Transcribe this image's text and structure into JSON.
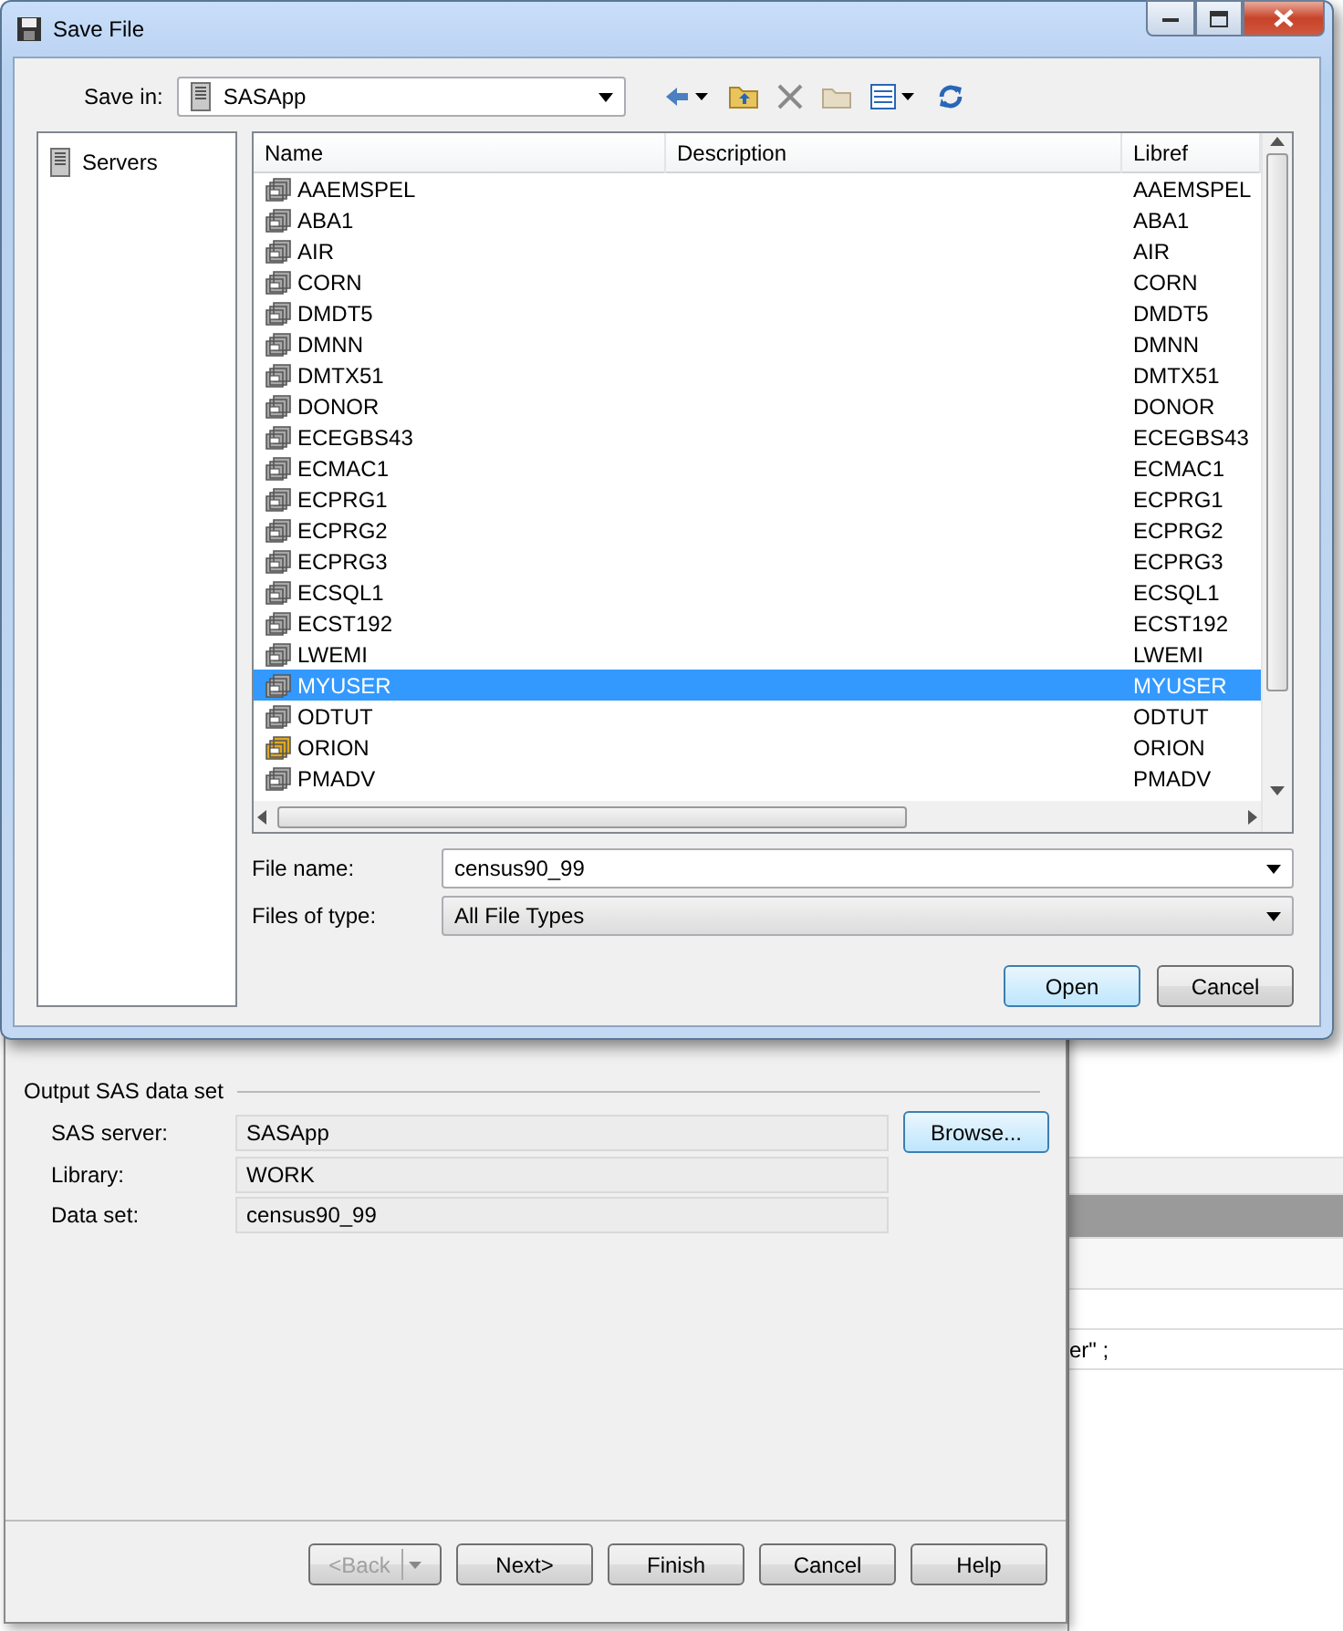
{
  "dialog": {
    "title": "Save File",
    "save_in": {
      "label": "Save in:",
      "value": "SASApp"
    },
    "sidebar": {
      "items": [
        {
          "label": "Servers",
          "selected": false
        }
      ]
    },
    "list": {
      "columns": [
        "Name",
        "Description",
        "Libref"
      ],
      "rows": [
        {
          "name": "AAEMSPEL",
          "libref": "AAEMSPEL",
          "selected": false,
          "color": "#a8a8a8"
        },
        {
          "name": "ABA1",
          "libref": "ABA1",
          "selected": false,
          "color": "#a8a8a8"
        },
        {
          "name": "AIR",
          "libref": "AIR",
          "selected": false,
          "color": "#a8a8a8"
        },
        {
          "name": "CORN",
          "libref": "CORN",
          "selected": false,
          "color": "#a8a8a8"
        },
        {
          "name": "DMDT5",
          "libref": "DMDT5",
          "selected": false,
          "color": "#a8a8a8"
        },
        {
          "name": "DMNN",
          "libref": "DMNN",
          "selected": false,
          "color": "#a8a8a8"
        },
        {
          "name": "DMTX51",
          "libref": "DMTX51",
          "selected": false,
          "color": "#a8a8a8"
        },
        {
          "name": "DONOR",
          "libref": "DONOR",
          "selected": false,
          "color": "#a8a8a8"
        },
        {
          "name": "ECEGBS43",
          "libref": "ECEGBS43",
          "selected": false,
          "color": "#a8a8a8"
        },
        {
          "name": "ECMAC1",
          "libref": "ECMAC1",
          "selected": false,
          "color": "#a8a8a8"
        },
        {
          "name": "ECPRG1",
          "libref": "ECPRG1",
          "selected": false,
          "color": "#a8a8a8"
        },
        {
          "name": "ECPRG2",
          "libref": "ECPRG2",
          "selected": false,
          "color": "#a8a8a8"
        },
        {
          "name": "ECPRG3",
          "libref": "ECPRG3",
          "selected": false,
          "color": "#a8a8a8"
        },
        {
          "name": "ECSQL1",
          "libref": "ECSQL1",
          "selected": false,
          "color": "#a8a8a8"
        },
        {
          "name": "ECST192",
          "libref": "ECST192",
          "selected": false,
          "color": "#a8a8a8"
        },
        {
          "name": "LWEMI",
          "libref": "LWEMI",
          "selected": false,
          "color": "#a8a8a8"
        },
        {
          "name": "MYUSER",
          "libref": "MYUSER",
          "selected": true,
          "color": "#a8a8a8"
        },
        {
          "name": "ODTUT",
          "libref": "ODTUT",
          "selected": false,
          "color": "#a8a8a8"
        },
        {
          "name": "ORION",
          "libref": "ORION",
          "selected": false,
          "color": "#e0a820"
        },
        {
          "name": "PMADV",
          "libref": "PMADV",
          "selected": false,
          "color": "#a8a8a8"
        }
      ]
    },
    "file_name": {
      "label": "File name:",
      "value": "census90_99"
    },
    "file_type": {
      "label": "Files of type:",
      "value": "All File Types"
    },
    "buttons": [
      {
        "label": "Open",
        "default": true
      },
      {
        "label": "Cancel",
        "default": false
      }
    ]
  },
  "wizard": {
    "section": "Output SAS data set",
    "fields": [
      {
        "label": "SAS server:",
        "value": "SASApp"
      },
      {
        "label": "Library:",
        "value": "WORK"
      },
      {
        "label": "Data set:",
        "value": "census90_99"
      }
    ],
    "browse": "Browse...",
    "buttons": [
      {
        "label": "<Back",
        "disabled": true,
        "kind": "split"
      },
      {
        "label": "Next>",
        "disabled": false,
        "kind": "plain"
      },
      {
        "label": "Finish",
        "disabled": false,
        "kind": "plain"
      },
      {
        "label": "Cancel",
        "disabled": false,
        "kind": "plain"
      },
      {
        "label": "Help",
        "disabled": false,
        "kind": "plain"
      }
    ]
  },
  "background_window": {
    "text": "er\" ;"
  }
}
